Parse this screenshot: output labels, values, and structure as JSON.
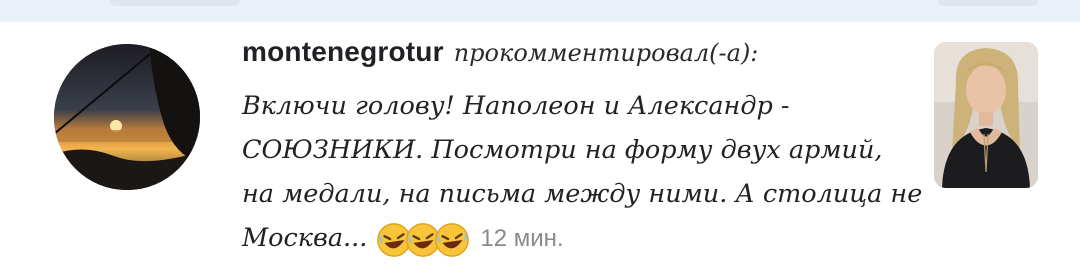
{
  "comment": {
    "username": "montenegrotur",
    "action": "прокомментировал(-а):",
    "lines": [
      "Включи голову! Наполеон и Александр -",
      "СОЮЗНИКИ. Посмотри на форму двух армий,",
      "на медали, на письма между ними. А столица не",
      "Москва..."
    ],
    "emojis": [
      "rolling-on-floor-laughing",
      "rolling-on-floor-laughing",
      "rolling-on-floor-laughing"
    ],
    "timestamp": "12 мин."
  }
}
